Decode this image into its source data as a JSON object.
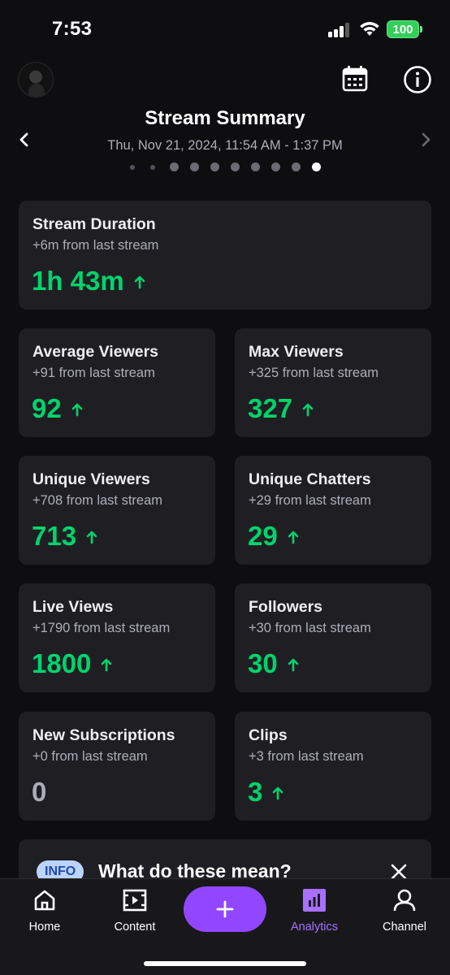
{
  "status_bar": {
    "time": "7:53",
    "battery": "100"
  },
  "header": {
    "title": "Stream Summary",
    "date_range": "Thu, Nov 21, 2024, 11:54 AM - 1:37 PM"
  },
  "pager": {
    "total": 10,
    "active_index": 9
  },
  "stats": {
    "stream_duration": {
      "label": "Stream Duration",
      "change": "+6m from last stream",
      "value": "1h 43m",
      "trend": "up"
    },
    "average_viewers": {
      "label": "Average Viewers",
      "change": "+91 from last stream",
      "value": "92",
      "trend": "up"
    },
    "max_viewers": {
      "label": "Max Viewers",
      "change": "+325 from last stream",
      "value": "327",
      "trend": "up"
    },
    "unique_viewers": {
      "label": "Unique Viewers",
      "change": "+708 from last stream",
      "value": "713",
      "trend": "up"
    },
    "unique_chatters": {
      "label": "Unique Chatters",
      "change": "+29 from last stream",
      "value": "29",
      "trend": "up"
    },
    "live_views": {
      "label": "Live Views",
      "change": "+1790 from last stream",
      "value": "1800",
      "trend": "up"
    },
    "followers": {
      "label": "Followers",
      "change": "+30 from last stream",
      "value": "30",
      "trend": "up"
    },
    "new_subscriptions": {
      "label": "New Subscriptions",
      "change": "+0 from last stream",
      "value": "0",
      "trend": "none"
    },
    "clips": {
      "label": "Clips",
      "change": "+3 from last stream",
      "value": "3",
      "trend": "up"
    }
  },
  "info_banner": {
    "badge": "INFO",
    "title": "What do these mean?"
  },
  "bottom_nav": {
    "home": "Home",
    "content": "Content",
    "analytics": "Analytics",
    "channel": "Channel",
    "active": "analytics"
  },
  "colors": {
    "background": "#0e0e10",
    "card": "#1f1f23",
    "positive": "#00d36d",
    "accent": "#9147ff",
    "accent_text": "#a970ff"
  },
  "icons": {
    "calendar": "calendar-icon",
    "info": "info-icon",
    "prev": "chevron-left-icon",
    "next": "chevron-right-icon",
    "trend_up": "arrow-up-icon",
    "close": "close-icon",
    "home": "home-icon",
    "content": "video-content-icon",
    "create": "plus-icon",
    "analytics": "bar-chart-icon",
    "channel": "person-icon"
  }
}
